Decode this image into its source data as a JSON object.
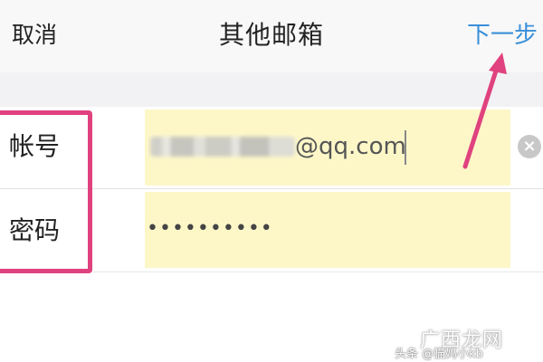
{
  "navbar": {
    "cancel_label": "取消",
    "title": "其他邮箱",
    "next_label": "下一步"
  },
  "form": {
    "account": {
      "label": "帐号",
      "value_visible": "@qq.com"
    },
    "password": {
      "label": "密码",
      "value": "••••••••••"
    }
  },
  "watermark": {
    "logo": "广西龙网",
    "handle": "头条 @猫妈小kb"
  },
  "colors": {
    "accent": "#3a8fd9",
    "highlight": "#e0427f",
    "field_bg": "#fdf7c8"
  },
  "icons": {
    "clear": "clear-circle-icon"
  }
}
